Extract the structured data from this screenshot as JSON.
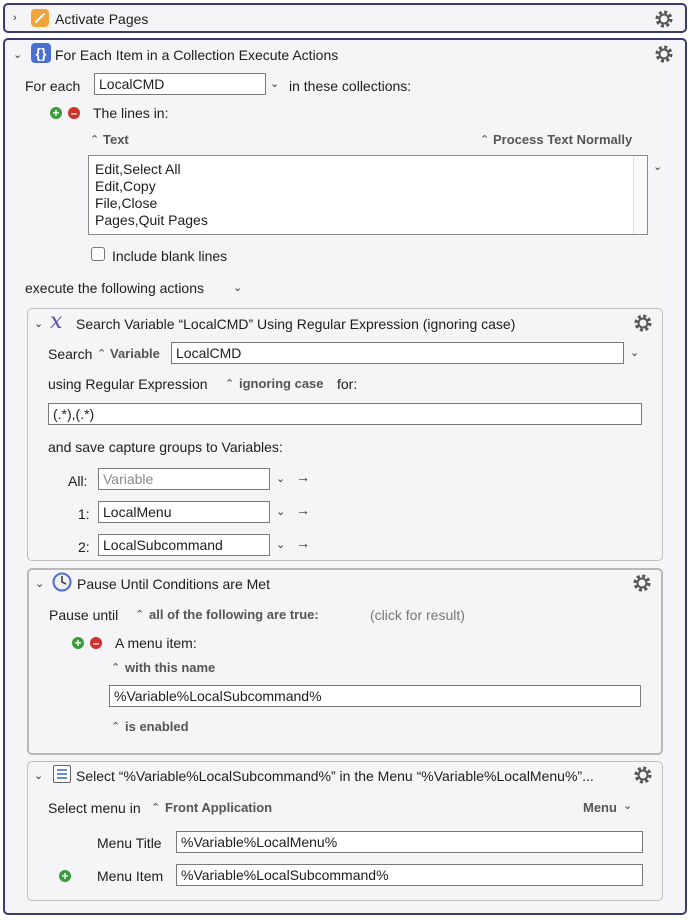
{
  "action1": {
    "title": "Activate Pages",
    "icon": "pages-icon"
  },
  "action2": {
    "title": "For Each Item in a Collection Execute Actions",
    "for_each_label": "For each",
    "variable_value": "LocalCMD",
    "in_collections_label": "in these collections:",
    "lines_in_label": "The lines in:",
    "source_type": "Text",
    "process_mode": "Process Text Normally",
    "lines": [
      "Edit,Select All",
      "Edit,Copy",
      "File,Close",
      "Pages,Quit Pages"
    ],
    "include_blank_label": "Include blank lines",
    "execute_label": "execute the following actions"
  },
  "search_action": {
    "title": "Search Variable “LocalCMD” Using Regular Expression (ignoring case)",
    "search_label": "Search",
    "source_type": "Variable",
    "variable_value": "LocalCMD",
    "using_label": "using Regular Expression",
    "case_mode": "ignoring case",
    "for_label": "for:",
    "regex_value": "(.*),(.*)",
    "save_label": "and save capture groups to Variables:",
    "all_label": "All:",
    "all_placeholder": "Variable",
    "g1_label": "1:",
    "g1_value": "LocalMenu",
    "g2_label": "2:",
    "g2_value": "LocalSubcommand"
  },
  "pause_action": {
    "title": "Pause Until Conditions are Met",
    "pause_label": "Pause until",
    "condition_mode": "all of the following are true:",
    "result_hint": "(click for result)",
    "menu_item_label": "A menu item:",
    "match_mode": "with this name",
    "name_value": "%Variable%LocalSubcommand%",
    "state_mode": "is enabled"
  },
  "select_action": {
    "title": "Select “%Variable%LocalSubcommand%” in the Menu “%Variable%LocalMenu%”...",
    "select_in_label": "Select menu in",
    "app_mode": "Front Application",
    "menu_dropdown": "Menu",
    "menu_title_label": "Menu Title",
    "menu_title_value": "%Variable%LocalMenu%",
    "menu_item_label": "Menu Item",
    "menu_item_value": "%Variable%LocalSubcommand%"
  }
}
